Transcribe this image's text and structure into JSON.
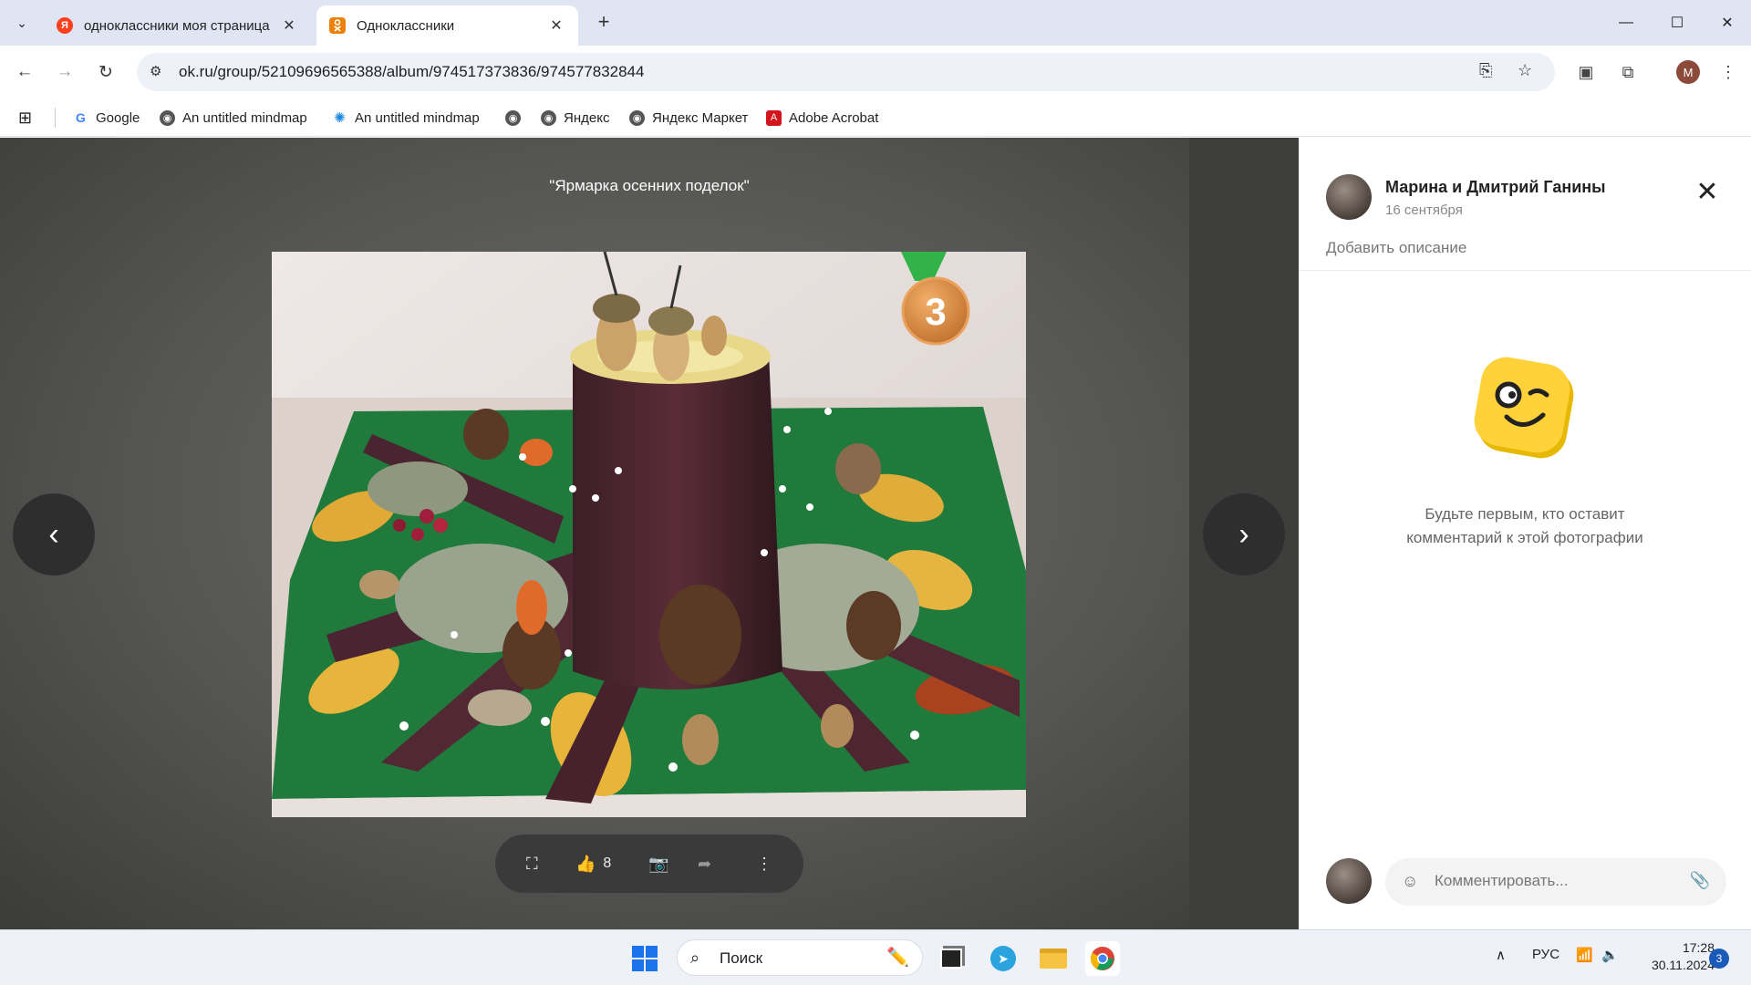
{
  "browser": {
    "tabs": [
      {
        "title": "одноклассники моя страница",
        "favicon_letter": "Я",
        "favicon_color": "#fc3f1d"
      },
      {
        "title": "Одноклассники",
        "favicon_letter": "ok",
        "favicon_color": "#ee8208"
      }
    ],
    "url": "ok.ru/group/52109696565388/album/974517373836/974577832844",
    "profile_initial": "M",
    "bookmarks": [
      {
        "label": "Google",
        "icon": "google-icon"
      },
      {
        "label": "An untitled mindmap",
        "icon": "globe-icon"
      },
      {
        "label": "An untitled mindmap",
        "icon": "mindmap-icon"
      },
      {
        "label": "",
        "icon": "globe-icon"
      },
      {
        "label": "Яндекс",
        "icon": "globe-icon"
      },
      {
        "label": "Яндекс Маркет",
        "icon": "globe-icon"
      },
      {
        "label": "Adobe Acrobat",
        "icon": "acrobat-icon"
      }
    ]
  },
  "viewer": {
    "album_title": "\"Ярмарка осенних поделок\"",
    "medal_number": "3",
    "likes": "8"
  },
  "panel": {
    "author": "Марина и Дмитрий Ганины",
    "date": "16 сентября",
    "add_description": "Добавить описание",
    "empty_line1": "Будьте первым, кто оставит",
    "empty_line2": "комментарий к этой фотографии",
    "comment_placeholder": "Комментировать..."
  },
  "taskbar": {
    "search_label": "Поиск",
    "language": "РУС",
    "time": "17:28",
    "date": "30.11.2024",
    "notifications": "3"
  },
  "colors": {
    "accent_orange": "#ee8208",
    "viewer_bg": "#555553",
    "emoji_yellow": "#ffd23a"
  }
}
